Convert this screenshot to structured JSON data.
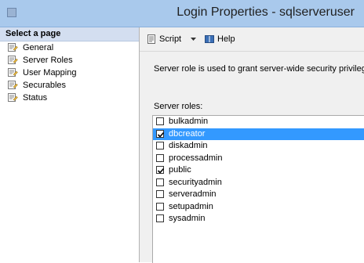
{
  "window": {
    "title": "Login Properties - sqlserveruser"
  },
  "left_panel": {
    "header": "Select a page",
    "items": [
      {
        "label": "General",
        "icon": "page-icon"
      },
      {
        "label": "Server Roles",
        "icon": "page-icon"
      },
      {
        "label": "User Mapping",
        "icon": "page-icon"
      },
      {
        "label": "Securables",
        "icon": "page-icon"
      },
      {
        "label": "Status",
        "icon": "page-icon"
      }
    ]
  },
  "toolbar": {
    "script_label": "Script",
    "help_label": "Help"
  },
  "main": {
    "description": "Server role is used to grant server-wide security privileges",
    "roles_label": "Server roles:",
    "roles": [
      {
        "name": "bulkadmin",
        "checked": false,
        "selected": false
      },
      {
        "name": "dbcreator",
        "checked": true,
        "selected": true
      },
      {
        "name": "diskadmin",
        "checked": false,
        "selected": false
      },
      {
        "name": "processadmin",
        "checked": false,
        "selected": false
      },
      {
        "name": "public",
        "checked": true,
        "selected": false
      },
      {
        "name": "securityadmin",
        "checked": false,
        "selected": false
      },
      {
        "name": "serveradmin",
        "checked": false,
        "selected": false
      },
      {
        "name": "setupadmin",
        "checked": false,
        "selected": false
      },
      {
        "name": "sysadmin",
        "checked": false,
        "selected": false
      }
    ]
  },
  "colors": {
    "titlebar": "#a9c9ec",
    "selection": "#3399ff",
    "left_header": "#d3def0"
  }
}
